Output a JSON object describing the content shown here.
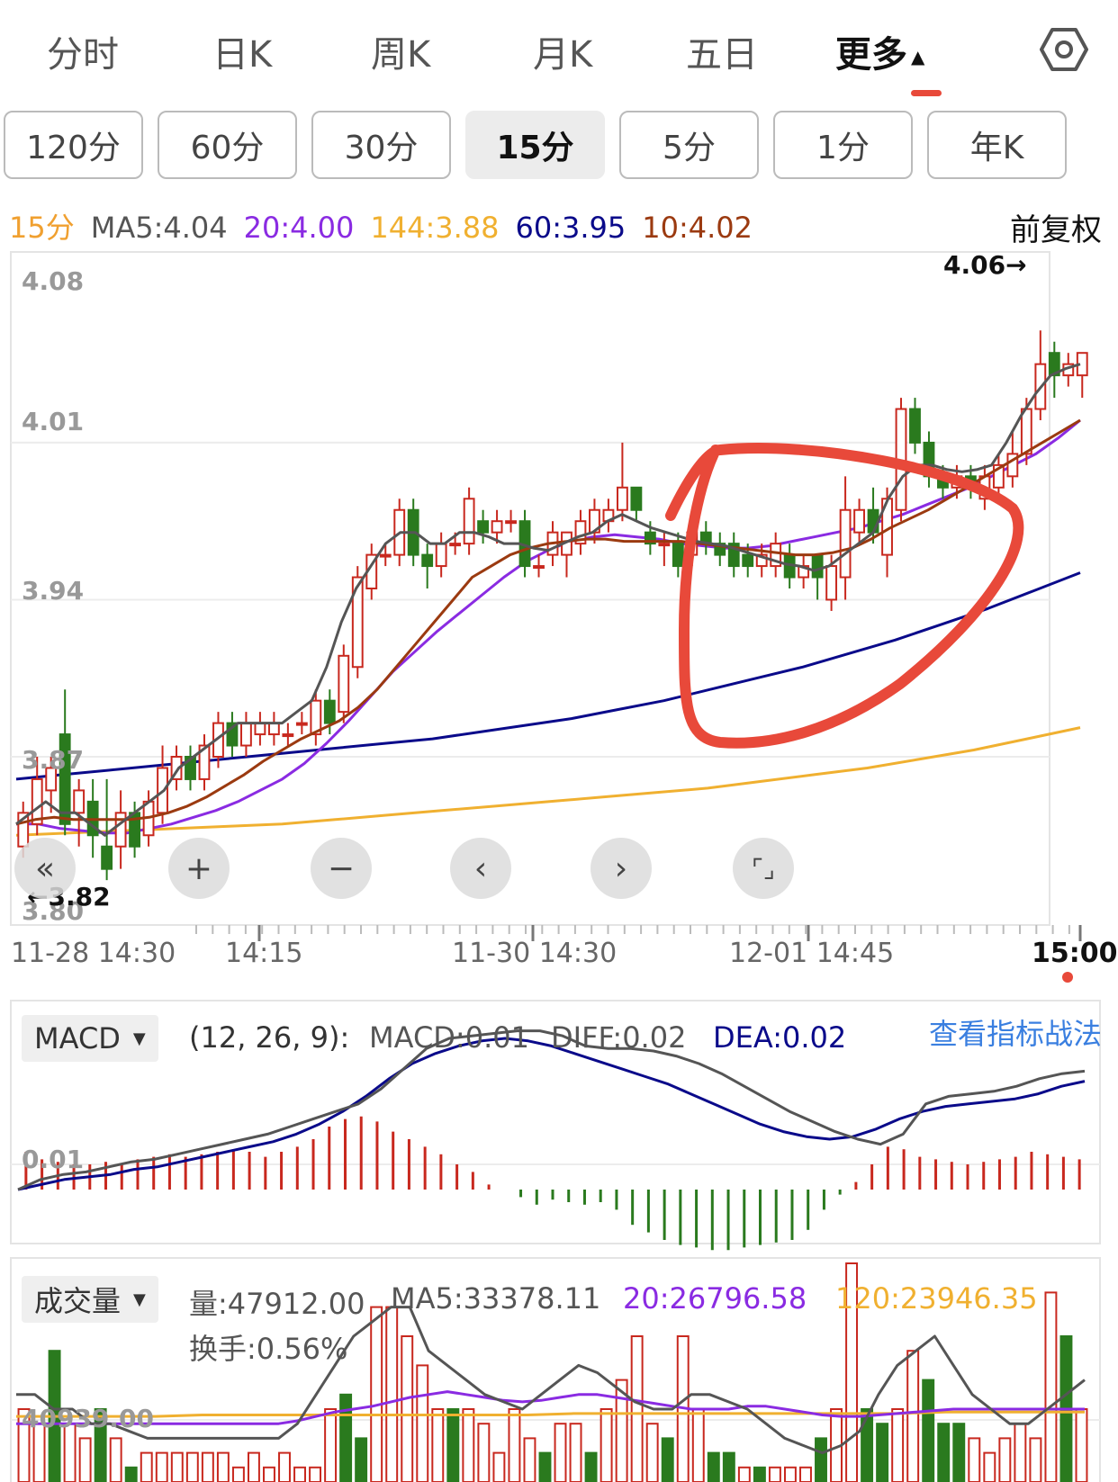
{
  "top_tabs": [
    {
      "label": "分时",
      "active": false
    },
    {
      "label": "日K",
      "active": false
    },
    {
      "label": "周K",
      "active": false
    },
    {
      "label": "月K",
      "active": false
    },
    {
      "label": "五日",
      "active": false
    },
    {
      "label": "更多",
      "active": true
    }
  ],
  "settings_icon": "hexagon-gear-icon",
  "periods": [
    {
      "label": "120分",
      "active": false
    },
    {
      "label": "60分",
      "active": false
    },
    {
      "label": "30分",
      "active": false
    },
    {
      "label": "15分",
      "active": true
    },
    {
      "label": "5分",
      "active": false
    },
    {
      "label": "1分",
      "active": false
    },
    {
      "label": "年K",
      "active": false
    }
  ],
  "legend": {
    "period": "15分",
    "ma5": "MA5:4.04",
    "ma20": "20:4.00",
    "ma144": "144:3.88",
    "ma60": "60:3.95",
    "ma10": "10:4.02",
    "adjust": "前复权"
  },
  "colors": {
    "up": "#c8281e",
    "down": "#2a7a1e",
    "ma5": "#555555",
    "ma10": "#9b3a10",
    "ma20": "#8a2be2",
    "ma60": "#0a0a8a",
    "ma144": "#f0b030",
    "annotation": "#e8493a",
    "period_label": "#f0a030",
    "link": "#3a7fe0"
  },
  "price_axis": [
    "4.08",
    "4.01",
    "3.94",
    "3.87",
    "3.80"
  ],
  "high_marker": "4.06→",
  "low_marker": "←3.82",
  "nav_buttons": [
    "«",
    "+",
    "−",
    "‹",
    "›",
    "⌜⌟"
  ],
  "time_labels": [
    "11-28 14:30",
    "14:15",
    "11-30 14:30",
    "12-01 14:45",
    "15:00"
  ],
  "chart_data": {
    "type": "candlestick",
    "ylim": [
      3.8,
      4.09
    ],
    "candles": [
      [
        3.83,
        3.845,
        3.825,
        3.85
      ],
      [
        3.84,
        3.86,
        3.835,
        3.87
      ],
      [
        3.855,
        3.865,
        3.845,
        3.87
      ],
      [
        3.88,
        3.84,
        3.835,
        3.9
      ],
      [
        3.845,
        3.855,
        3.83,
        3.86
      ],
      [
        3.85,
        3.835,
        3.825,
        3.86
      ],
      [
        3.83,
        3.82,
        3.815,
        3.86
      ],
      [
        3.83,
        3.845,
        3.82,
        3.855
      ],
      [
        3.845,
        3.83,
        3.825,
        3.85
      ],
      [
        3.835,
        3.85,
        3.83,
        3.855
      ],
      [
        3.845,
        3.865,
        3.84,
        3.875
      ],
      [
        3.86,
        3.87,
        3.855,
        3.875
      ],
      [
        3.87,
        3.86,
        3.855,
        3.875
      ],
      [
        3.86,
        3.875,
        3.855,
        3.88
      ],
      [
        3.87,
        3.885,
        3.865,
        3.89
      ],
      [
        3.885,
        3.875,
        3.87,
        3.89
      ],
      [
        3.875,
        3.885,
        3.87,
        3.89
      ],
      [
        3.88,
        3.885,
        3.875,
        3.89
      ],
      [
        3.88,
        3.885,
        3.875,
        3.89
      ],
      [
        3.88,
        3.88,
        3.875,
        3.885
      ],
      [
        3.885,
        3.885,
        3.88,
        3.89
      ],
      [
        3.88,
        3.895,
        3.875,
        3.9
      ],
      [
        3.895,
        3.885,
        3.88,
        3.9
      ],
      [
        3.89,
        3.915,
        3.885,
        3.92
      ],
      [
        3.91,
        3.95,
        3.905,
        3.955
      ],
      [
        3.945,
        3.96,
        3.94,
        3.965
      ],
      [
        3.96,
        3.96,
        3.955,
        3.965
      ],
      [
        3.96,
        3.98,
        3.955,
        3.985
      ],
      [
        3.98,
        3.96,
        3.955,
        3.985
      ],
      [
        3.96,
        3.955,
        3.945,
        3.965
      ],
      [
        3.955,
        3.965,
        3.95,
        3.97
      ],
      [
        3.965,
        3.965,
        3.96,
        3.97
      ],
      [
        3.965,
        3.985,
        3.96,
        3.99
      ],
      [
        3.975,
        3.97,
        3.965,
        3.98
      ],
      [
        3.97,
        3.975,
        3.965,
        3.98
      ],
      [
        3.975,
        3.975,
        3.97,
        3.98
      ],
      [
        3.975,
        3.955,
        3.95,
        3.98
      ],
      [
        3.955,
        3.955,
        3.95,
        3.96
      ],
      [
        3.96,
        3.97,
        3.955,
        3.975
      ],
      [
        3.96,
        3.97,
        3.95,
        3.97
      ],
      [
        3.965,
        3.975,
        3.96,
        3.98
      ],
      [
        3.97,
        3.98,
        3.965,
        3.985
      ],
      [
        3.975,
        3.98,
        3.97,
        3.985
      ],
      [
        3.98,
        3.99,
        3.975,
        4.01
      ],
      [
        3.99,
        3.98,
        3.975,
        3.99
      ],
      [
        3.97,
        3.965,
        3.96,
        3.975
      ],
      [
        3.965,
        3.965,
        3.955,
        3.97
      ],
      [
        3.965,
        3.955,
        3.95,
        3.97
      ],
      [
        3.96,
        3.97,
        3.955,
        3.975
      ],
      [
        3.97,
        3.965,
        3.96,
        3.975
      ],
      [
        3.965,
        3.96,
        3.955,
        3.97
      ],
      [
        3.965,
        3.955,
        3.95,
        3.97
      ],
      [
        3.96,
        3.955,
        3.95,
        3.965
      ],
      [
        3.955,
        3.96,
        3.95,
        3.965
      ],
      [
        3.955,
        3.965,
        3.95,
        3.97
      ],
      [
        3.96,
        3.95,
        3.945,
        3.965
      ],
      [
        3.95,
        3.955,
        3.945,
        3.96
      ],
      [
        3.96,
        3.95,
        3.94,
        3.96
      ],
      [
        3.94,
        3.955,
        3.935,
        3.96
      ],
      [
        3.95,
        3.98,
        3.94,
        3.995
      ],
      [
        3.97,
        3.98,
        3.965,
        3.985
      ],
      [
        3.98,
        3.97,
        3.965,
        3.99
      ],
      [
        3.96,
        3.985,
        3.95,
        3.99
      ],
      [
        3.98,
        4.025,
        3.975,
        4.03
      ],
      [
        4.025,
        4.01,
        4.005,
        4.03
      ],
      [
        4.01,
        3.995,
        3.99,
        4.015
      ],
      [
        3.995,
        3.99,
        3.985,
        4.0
      ],
      [
        3.99,
        3.995,
        3.985,
        4.0
      ],
      [
        3.995,
        3.99,
        3.985,
        4.0
      ],
      [
        3.985,
        3.995,
        3.98,
        4.0
      ],
      [
        3.99,
        4.0,
        3.985,
        4.005
      ],
      [
        3.995,
        4.005,
        3.99,
        4.015
      ],
      [
        4.005,
        4.025,
        4.0,
        4.03
      ],
      [
        4.025,
        4.045,
        4.02,
        4.06
      ],
      [
        4.05,
        4.04,
        4.03,
        4.055
      ],
      [
        4.04,
        4.045,
        4.035,
        4.05
      ],
      [
        4.04,
        4.05,
        4.03,
        4.05
      ]
    ],
    "ma5": [
      3.84,
      3.845,
      3.85,
      3.845,
      3.845,
      3.84,
      3.835,
      3.84,
      3.845,
      3.85,
      3.855,
      3.865,
      3.87,
      3.875,
      3.88,
      3.885,
      3.885,
      3.885,
      3.885,
      3.89,
      3.895,
      3.91,
      3.93,
      3.945,
      3.955,
      3.965,
      3.97,
      3.97,
      3.965,
      3.965,
      3.97,
      3.97,
      3.968,
      3.965,
      3.965,
      3.963,
      3.962,
      3.965,
      3.968,
      3.97,
      3.975,
      3.978,
      3.975,
      3.972,
      3.97,
      3.968,
      3.966,
      3.965,
      3.964,
      3.962,
      3.96,
      3.958,
      3.956,
      3.955,
      3.953,
      3.955,
      3.96,
      3.965,
      3.97,
      3.985,
      3.995,
      4.0,
      4.0,
      3.998,
      3.997,
      3.998,
      4.0,
      4.01,
      4.022,
      4.032,
      4.04,
      4.043,
      4.045
    ],
    "ma10": [
      3.84,
      3.842,
      3.843,
      3.842,
      3.842,
      3.842,
      3.842,
      3.843,
      3.845,
      3.848,
      3.852,
      3.857,
      3.862,
      3.868,
      3.873,
      3.878,
      3.882,
      3.886,
      3.892,
      3.9,
      3.91,
      3.92,
      3.93,
      3.94,
      3.95,
      3.955,
      3.96,
      3.963,
      3.965,
      3.966,
      3.967,
      3.967,
      3.966,
      3.966,
      3.966,
      3.966,
      3.965,
      3.964,
      3.963,
      3.962,
      3.961,
      3.96,
      3.96,
      3.961,
      3.963,
      3.967,
      3.972,
      3.976,
      3.98,
      3.985,
      3.99,
      3.995,
      4.0,
      4.005,
      4.01,
      4.015,
      4.02
    ],
    "ma20": [
      3.84,
      3.84,
      3.838,
      3.837,
      3.836,
      3.836,
      3.838,
      3.84,
      3.843,
      3.846,
      3.85,
      3.855,
      3.86,
      3.867,
      3.876,
      3.886,
      3.897,
      3.908,
      3.917,
      3.926,
      3.934,
      3.942,
      3.95,
      3.957,
      3.962,
      3.966,
      3.968,
      3.969,
      3.968,
      3.967,
      3.965,
      3.964,
      3.963,
      3.963,
      3.964,
      3.966,
      3.968,
      3.97,
      3.972,
      3.975,
      3.978,
      3.982,
      3.986,
      3.99,
      3.995,
      4.0,
      4.005,
      4.012,
      4.02
    ],
    "ma60": [
      3.86,
      3.862,
      3.864,
      3.866,
      3.868,
      3.87,
      3.872,
      3.874,
      3.876,
      3.878,
      3.881,
      3.884,
      3.887,
      3.891,
      3.895,
      3.9,
      3.905,
      3.91,
      3.916,
      3.922,
      3.929,
      3.936,
      3.944,
      3.952
    ],
    "ma144": [
      3.835,
      3.836,
      3.837,
      3.838,
      3.839,
      3.84,
      3.842,
      3.844,
      3.846,
      3.848,
      3.85,
      3.852,
      3.854,
      3.856,
      3.859,
      3.862,
      3.865,
      3.869,
      3.873,
      3.878,
      3.883
    ]
  },
  "macd": {
    "selector": "MACD",
    "params": "(12, 26, 9):",
    "macd": "MACD:0.01",
    "diff": "DIFF:0.02",
    "dea": "DEA:0.02",
    "link": "查看指标战法",
    "axis_label": "0.01",
    "diff_line": [
      0.0,
      0.004,
      0.006,
      0.007,
      0.009,
      0.011,
      0.012,
      0.014,
      0.016,
      0.018,
      0.02,
      0.022,
      0.025,
      0.028,
      0.031,
      0.034,
      0.04,
      0.048,
      0.056,
      0.06,
      0.061,
      0.062,
      0.063,
      0.063,
      0.061,
      0.057,
      0.056,
      0.056,
      0.055,
      0.053,
      0.05,
      0.046,
      0.041,
      0.036,
      0.031,
      0.027,
      0.023,
      0.02,
      0.018,
      0.022,
      0.034,
      0.037,
      0.038,
      0.039,
      0.041,
      0.044,
      0.046,
      0.047
    ],
    "dea_line": [
      0.0,
      0.002,
      0.004,
      0.005,
      0.006,
      0.008,
      0.009,
      0.011,
      0.013,
      0.015,
      0.017,
      0.019,
      0.022,
      0.026,
      0.031,
      0.037,
      0.044,
      0.05,
      0.054,
      0.057,
      0.059,
      0.06,
      0.059,
      0.057,
      0.054,
      0.051,
      0.048,
      0.045,
      0.042,
      0.038,
      0.034,
      0.03,
      0.026,
      0.023,
      0.021,
      0.02,
      0.021,
      0.024,
      0.028,
      0.031,
      0.033,
      0.034,
      0.035,
      0.036,
      0.038,
      0.041,
      0.043
    ],
    "histogram": [
      0.03,
      0.024,
      0.022,
      0.02,
      0.02,
      0.022,
      0.02,
      0.024,
      0.026,
      0.028,
      0.026,
      0.028,
      0.03,
      0.032,
      0.03,
      0.026,
      0.03,
      0.034,
      0.04,
      0.05,
      0.056,
      0.058,
      0.054,
      0.046,
      0.04,
      0.034,
      0.028,
      0.02,
      0.014,
      0.004,
      0.0,
      -0.006,
      -0.012,
      -0.008,
      -0.01,
      -0.012,
      -0.01,
      -0.016,
      -0.028,
      -0.034,
      -0.04,
      -0.044,
      -0.046,
      -0.048,
      -0.048,
      -0.046,
      -0.044,
      -0.042,
      -0.04,
      -0.032,
      -0.016,
      -0.004,
      0.006,
      0.02,
      0.034,
      0.032,
      0.026,
      0.024,
      0.022,
      0.02,
      0.022,
      0.024,
      0.026,
      0.03,
      0.028,
      0.026,
      0.024
    ]
  },
  "volume": {
    "selector": "成交量",
    "vol": "量:47912.00",
    "ma5": "MA5:33378.11",
    "ma20": "20:26796.58",
    "ma120": "120:23946.35",
    "turnover": "换手:0.56%",
    "axis_label": "40939.00",
    "bars": [
      [
        0.05,
        1
      ],
      [
        0.04,
        1
      ],
      [
        0.09,
        0
      ],
      [
        0.04,
        1
      ],
      [
        0.03,
        1
      ],
      [
        0.05,
        0
      ],
      [
        0.03,
        1
      ],
      [
        0.01,
        0
      ],
      [
        0.02,
        1
      ],
      [
        0.02,
        1
      ],
      [
        0.02,
        1
      ],
      [
        0.02,
        1
      ],
      [
        0.02,
        1
      ],
      [
        0.02,
        1
      ],
      [
        0.01,
        1
      ],
      [
        0.02,
        1
      ],
      [
        0.01,
        1
      ],
      [
        0.02,
        1
      ],
      [
        0.01,
        1
      ],
      [
        0.01,
        1
      ],
      [
        0.05,
        1
      ],
      [
        0.06,
        0
      ],
      [
        0.03,
        0
      ],
      [
        0.12,
        1
      ],
      [
        0.12,
        1
      ],
      [
        0.1,
        1
      ],
      [
        0.08,
        1
      ],
      [
        0.05,
        1
      ],
      [
        0.05,
        0
      ],
      [
        0.05,
        1
      ],
      [
        0.04,
        1
      ],
      [
        0.02,
        1
      ],
      [
        0.05,
        1
      ],
      [
        0.03,
        1
      ],
      [
        0.02,
        0
      ],
      [
        0.04,
        1
      ],
      [
        0.04,
        1
      ],
      [
        0.02,
        0
      ],
      [
        0.05,
        1
      ],
      [
        0.07,
        1
      ],
      [
        0.1,
        1
      ],
      [
        0.04,
        1
      ],
      [
        0.03,
        0
      ],
      [
        0.1,
        1
      ],
      [
        0.05,
        1
      ],
      [
        0.02,
        0
      ],
      [
        0.02,
        0
      ],
      [
        0.01,
        1
      ],
      [
        0.01,
        0
      ],
      [
        0.01,
        1
      ],
      [
        0.01,
        1
      ],
      [
        0.01,
        1
      ],
      [
        0.03,
        0
      ],
      [
        0.05,
        1
      ],
      [
        0.15,
        1
      ],
      [
        0.05,
        0
      ],
      [
        0.04,
        0
      ],
      [
        0.05,
        1
      ],
      [
        0.09,
        1
      ],
      [
        0.07,
        0
      ],
      [
        0.04,
        0
      ],
      [
        0.04,
        0
      ],
      [
        0.03,
        1
      ],
      [
        0.02,
        1
      ],
      [
        0.03,
        1
      ],
      [
        0.04,
        1
      ],
      [
        0.03,
        1
      ],
      [
        0.13,
        1
      ],
      [
        0.1,
        0
      ],
      [
        0.05,
        1
      ]
    ],
    "ma5_line": [
      0.06,
      0.06,
      0.05,
      0.05,
      0.04,
      0.04,
      0.035,
      0.03,
      0.03,
      0.03,
      0.03,
      0.03,
      0.03,
      0.03,
      0.03,
      0.04,
      0.06,
      0.08,
      0.1,
      0.11,
      0.12,
      0.12,
      0.09,
      0.08,
      0.07,
      0.06,
      0.055,
      0.05,
      0.06,
      0.07,
      0.08,
      0.075,
      0.065,
      0.055,
      0.05,
      0.05,
      0.06,
      0.06,
      0.055,
      0.05,
      0.04,
      0.03,
      0.025,
      0.02,
      0.025,
      0.035,
      0.06,
      0.08,
      0.09,
      0.1,
      0.08,
      0.06,
      0.05,
      0.04,
      0.04,
      0.05,
      0.06,
      0.07
    ],
    "ma20_line": [
      0.04,
      0.04,
      0.04,
      0.04,
      0.04,
      0.04,
      0.04,
      0.04,
      0.04,
      0.04,
      0.04,
      0.04,
      0.04,
      0.04,
      0.04,
      0.042,
      0.045,
      0.048,
      0.05,
      0.052,
      0.055,
      0.058,
      0.06,
      0.062,
      0.06,
      0.058,
      0.056,
      0.055,
      0.056,
      0.058,
      0.06,
      0.06,
      0.058,
      0.056,
      0.054,
      0.052,
      0.05,
      0.05,
      0.05,
      0.052,
      0.052,
      0.05,
      0.048,
      0.046,
      0.045,
      0.045,
      0.046,
      0.047,
      0.048,
      0.049,
      0.05,
      0.05,
      0.05,
      0.05,
      0.05,
      0.05,
      0.05,
      0.05
    ],
    "ma120_line": [
      0.045,
      0.045,
      0.045,
      0.045,
      0.046,
      0.046,
      0.046,
      0.046,
      0.046,
      0.046,
      0.046,
      0.046,
      0.047,
      0.047,
      0.047,
      0.047,
      0.047,
      0.047,
      0.047,
      0.047,
      0.048,
      0.048,
      0.048,
      0.048
    ]
  }
}
